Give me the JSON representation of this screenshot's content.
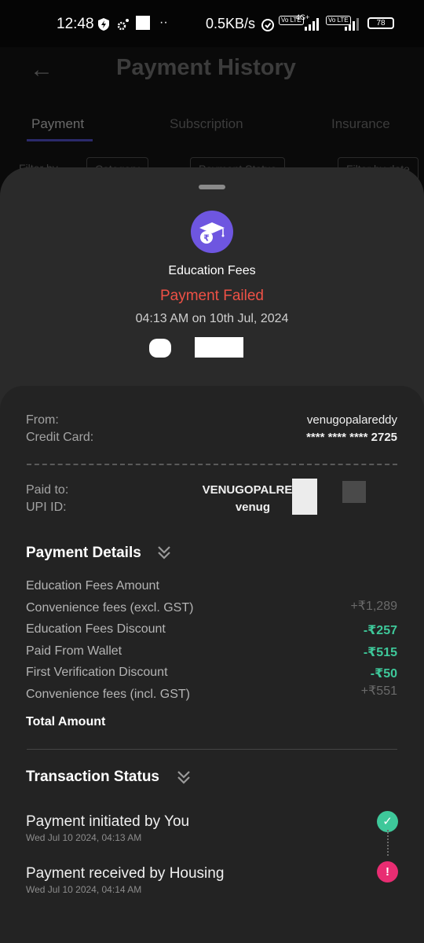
{
  "status_bar": {
    "time": "12:48",
    "net_speed": "0.5KB/s",
    "net_type": "4G+",
    "volte_label": "Vo LTE",
    "battery": "78"
  },
  "background_page": {
    "title": "Payment History",
    "tabs": [
      "Payment",
      "Subscription",
      "Insurance"
    ],
    "filter_label": "Filter by",
    "filters": [
      "Category",
      "Payment Status",
      "Filter by date"
    ]
  },
  "payment": {
    "category": "Education Fees",
    "status": "Payment Failed",
    "datetime": "04:13 AM on 10th Jul, 2024",
    "from_label": "From:",
    "from_value": "venugopalareddy",
    "card_label": "Credit Card:",
    "card_value": "**** **** **** 2725",
    "paid_to_label": "Paid to:",
    "paid_to_value": "VENUGOPALREDDY",
    "upi_label": "UPI ID:",
    "upi_value": "venug"
  },
  "payment_details": {
    "title": "Payment Details",
    "rows": [
      {
        "label": "Education Fees Amount",
        "value": ""
      },
      {
        "label": "Convenience fees (excl. GST)",
        "value": "+₹1,289"
      },
      {
        "label": "Education Fees Discount",
        "value": "-₹257"
      },
      {
        "label": "Paid From Wallet",
        "value": "-₹515"
      },
      {
        "label": "First Verification Discount",
        "value": "-₹50"
      },
      {
        "label": "Convenience fees (incl. GST)",
        "value": "+₹551"
      }
    ],
    "total_label": "Total Amount"
  },
  "transaction_status": {
    "title": "Transaction Status",
    "steps": [
      {
        "title": "Payment initiated by You",
        "time": "Wed Jul 10 2024, 04:13 AM",
        "icon": "check-icon"
      },
      {
        "title": "Payment received by Housing",
        "time": "Wed Jul 10 2024, 04:14 AM",
        "icon": "exclamation-icon"
      }
    ]
  },
  "colors": {
    "failed": "#ef5146",
    "discount": "#3ec89a",
    "success_icon": "#3ec89a",
    "error_icon": "#e82d72",
    "category_icon": "#6e56e0"
  }
}
